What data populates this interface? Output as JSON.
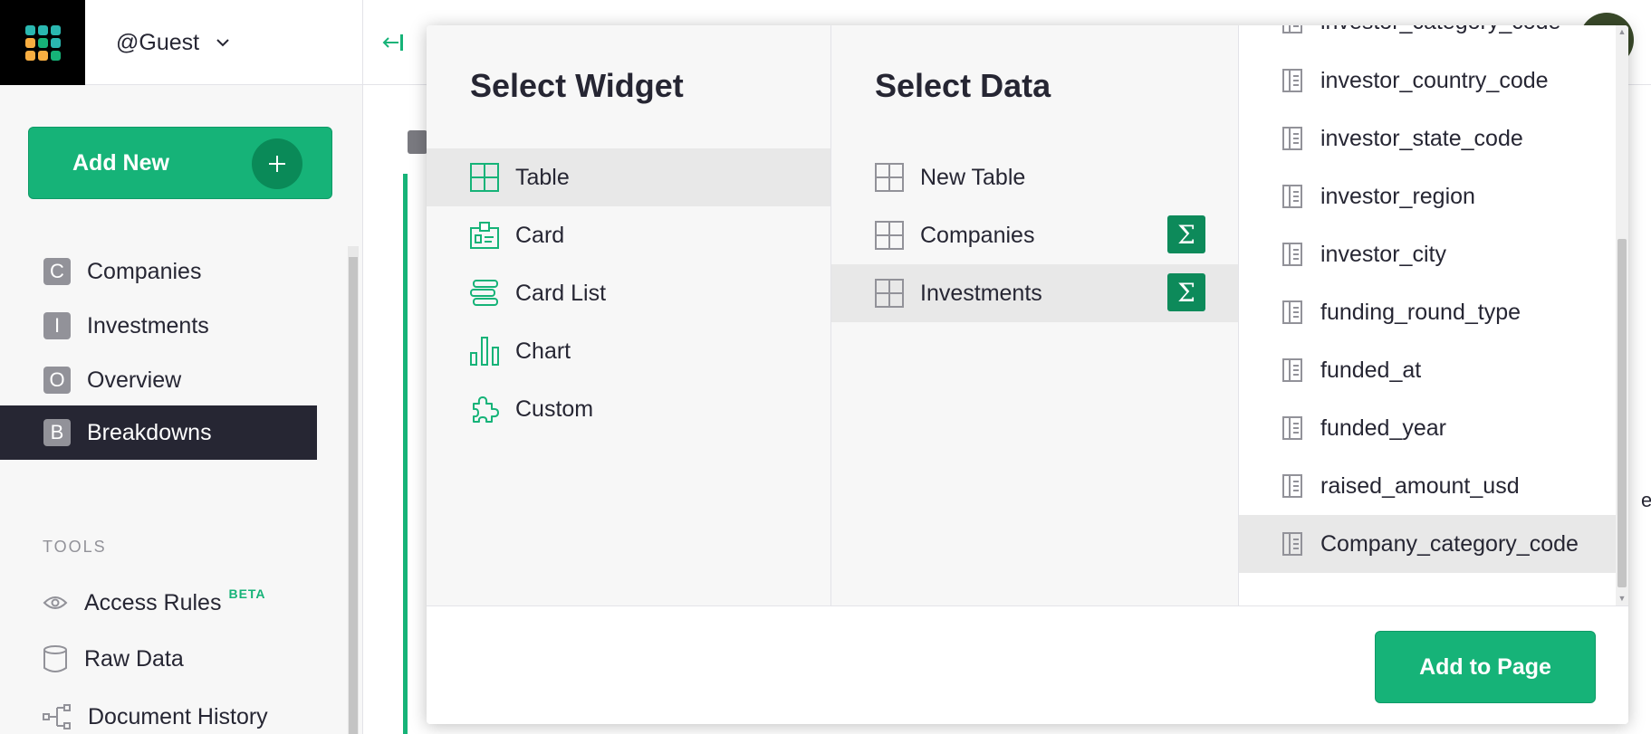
{
  "header": {
    "user_label": "@Guest"
  },
  "sidebar": {
    "add_new_label": "Add New",
    "pages": [
      {
        "badge": "C",
        "label": "Companies"
      },
      {
        "badge": "I",
        "label": "Investments"
      },
      {
        "badge": "O",
        "label": "Overview"
      },
      {
        "badge": "B",
        "label": "Breakdowns",
        "active": true
      }
    ],
    "tools_heading": "TOOLS",
    "tools": [
      {
        "label": "Access Rules",
        "badge": "BETA"
      },
      {
        "label": "Raw Data"
      },
      {
        "label": "Document History"
      }
    ]
  },
  "background": {
    "right_edge_text": "e"
  },
  "modal": {
    "widget": {
      "title": "Select Widget",
      "options": [
        {
          "label": "Table",
          "icon": "table-icon",
          "selected": true
        },
        {
          "label": "Card",
          "icon": "card-icon"
        },
        {
          "label": "Card List",
          "icon": "card-list-icon"
        },
        {
          "label": "Chart",
          "icon": "chart-icon"
        },
        {
          "label": "Custom",
          "icon": "puzzle-icon"
        }
      ]
    },
    "data": {
      "title": "Select Data",
      "options": [
        {
          "label": "New Table",
          "icon": "table-icon"
        },
        {
          "label": "Companies",
          "icon": "table-icon",
          "summary": "Σ"
        },
        {
          "label": "Investments",
          "icon": "table-icon",
          "summary": "Σ",
          "selected": true
        }
      ]
    },
    "fields": [
      "investor_category_code",
      "investor_country_code",
      "investor_state_code",
      "investor_region",
      "investor_city",
      "funding_round_type",
      "funded_at",
      "funded_year",
      "raised_amount_usd",
      "Company_category_code"
    ],
    "selected_field": "Company_category_code",
    "add_button_label": "Add to Page"
  },
  "colors": {
    "accent": "#16b378",
    "accent_dark": "#0d8a5a",
    "sidebar_active": "#262633"
  }
}
